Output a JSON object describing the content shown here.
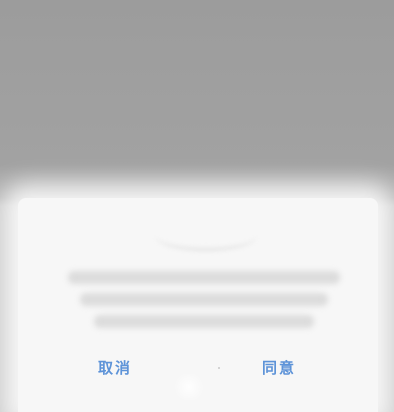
{
  "dialog": {
    "cancel_label": "取消",
    "agree_label": "同意",
    "accent_color": "#5d93d8"
  }
}
